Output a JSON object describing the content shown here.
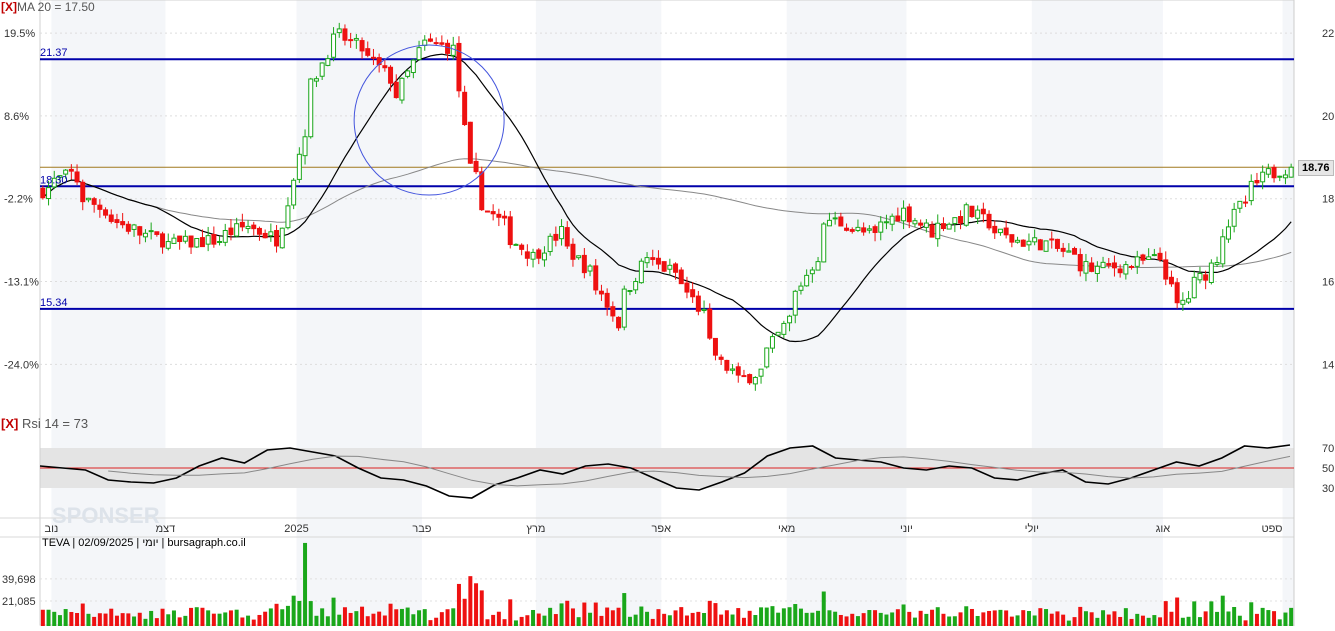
{
  "header": {
    "indicator_label": "MA 20 = 17.50",
    "rsi_label": "Rsi 14 = 73",
    "remove_glyph": "[X]",
    "footer_info": "TEVA | 02/09/2025 | יומי | bursagraph.co.il",
    "watermark": "SPONSER"
  },
  "colors": {
    "up": "#1aa71a",
    "down": "#ee1111",
    "level_line": "#0000aa",
    "ref_line": "#a0781e",
    "ma_short": "#000000",
    "ma_long": "#888888",
    "rsi_line": "#000000",
    "rsi_signal": "#888888",
    "rsi_midline": "#dd2222",
    "circle": "#4455dd",
    "band": "#e4e4e4"
  },
  "chart_data": [
    {
      "type": "candlestick",
      "title": "",
      "months": [
        "נוב",
        "דצמ",
        "2025",
        "פבר",
        "מרץ",
        "אפר",
        "מאי",
        "יוני",
        "יולי",
        "אוג",
        "ספט"
      ],
      "ylim": [
        12.8,
        22.8
      ],
      "price_ticks": [
        "22",
        "20",
        "18",
        "16",
        "14"
      ],
      "percent_ticks": [
        "19.5%",
        "8.6%",
        "-2.2%",
        "-13.1%",
        "-24.0%"
      ],
      "last_price": "18.76",
      "levels": [
        {
          "label": "21.37",
          "value": 21.37
        },
        {
          "label": "18.30",
          "value": 18.3
        },
        {
          "label": "15.34",
          "value": 15.34
        }
      ],
      "reference_line": 18.76,
      "circle_center": {
        "date": "2025-02-02",
        "value": 19.9
      },
      "anchors": [
        [
          "2024-10-30",
          18.2
        ],
        [
          "2024-11-06",
          18.6
        ],
        [
          "2024-11-10",
          18.0
        ],
        [
          "2024-11-20",
          17.3
        ],
        [
          "2024-12-01",
          16.9
        ],
        [
          "2024-12-12",
          17.0
        ],
        [
          "2024-12-20",
          17.4
        ],
        [
          "2024-12-28",
          16.9
        ],
        [
          "2025-01-03",
          20.2
        ],
        [
          "2025-01-10",
          22.1
        ],
        [
          "2025-01-20",
          21.3
        ],
        [
          "2025-01-26",
          20.5
        ],
        [
          "2025-01-31",
          21.8
        ],
        [
          "2025-02-09",
          21.6
        ],
        [
          "2025-02-12",
          18.7
        ],
        [
          "2025-02-17",
          17.7
        ],
        [
          "2025-02-28",
          16.5
        ],
        [
          "2025-03-06",
          17.2
        ],
        [
          "2025-03-17",
          15.7
        ],
        [
          "2025-03-20",
          15.0
        ],
        [
          "2025-03-27",
          16.6
        ],
        [
          "2025-04-05",
          16.1
        ],
        [
          "2025-04-10",
          15.2
        ],
        [
          "2025-04-15",
          14.0
        ],
        [
          "2025-04-20",
          13.6
        ],
        [
          "2025-04-25",
          13.9
        ],
        [
          "2025-05-03",
          15.5
        ],
        [
          "2025-05-12",
          17.5
        ],
        [
          "2025-05-22",
          17.1
        ],
        [
          "2025-05-30",
          17.8
        ],
        [
          "2025-06-05",
          17.2
        ],
        [
          "2025-06-15",
          17.7
        ],
        [
          "2025-06-25",
          17.0
        ],
        [
          "2025-07-05",
          16.9
        ],
        [
          "2025-07-15",
          16.3
        ],
        [
          "2025-07-25",
          16.4
        ],
        [
          "2025-08-02",
          16.6
        ],
        [
          "2025-08-05",
          15.4
        ],
        [
          "2025-08-12",
          16.2
        ],
        [
          "2025-08-20",
          17.8
        ],
        [
          "2025-08-27",
          18.6
        ],
        [
          "2025-09-02",
          18.76
        ]
      ]
    },
    {
      "type": "line",
      "title": "Rsi 14",
      "ylim": [
        0,
        100
      ],
      "y_ticks": [
        "70",
        "50",
        "30"
      ],
      "band": [
        30,
        70
      ],
      "midline": 50,
      "series": [
        {
          "values": [
            52,
            50,
            48,
            38,
            36,
            35,
            40,
            52,
            60,
            55,
            68,
            70,
            66,
            62,
            50,
            40,
            38,
            32,
            22,
            20,
            33,
            40,
            48,
            44,
            52,
            54,
            50,
            40,
            30,
            28,
            36,
            45,
            62,
            70,
            72,
            60,
            58,
            56,
            50,
            48,
            52,
            50,
            40,
            38,
            44,
            48,
            36,
            34,
            40,
            48,
            56,
            52,
            60,
            72,
            70,
            73
          ]
        }
      ]
    },
    {
      "type": "bar",
      "title": "",
      "y_ticks": [
        "39,698",
        "21,085"
      ],
      "ylim": [
        0,
        75000
      ]
    }
  ]
}
